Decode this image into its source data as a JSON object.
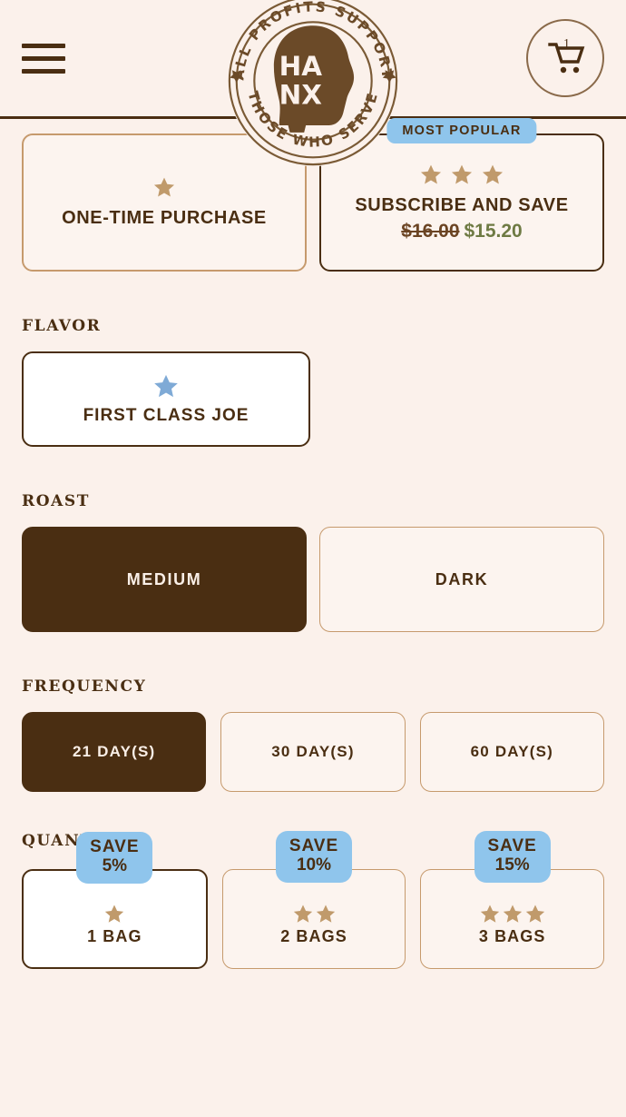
{
  "brand": {
    "logo_top_text": "ALL PROFITS SUPPORT",
    "logo_bottom_text": "THOSE WHO SERVE",
    "logo_initials_line1": "HA",
    "logo_initials_line2": "NX",
    "menu_icon": "hamburger-menu-icon",
    "cart_icon": "shopping-cart-icon",
    "cart_count": "1"
  },
  "colors": {
    "background": "#FBF1EB",
    "dark_brown": "#4A2E12",
    "tan_border": "#C69A6D",
    "star_tan": "#C09A6B",
    "star_blue": "#7FAAD6",
    "badge_blue": "#8FC5EC",
    "price_green": "#6E7A43",
    "cream": "#FCF4EF"
  },
  "plans": {
    "most_popular_label": "MOST POPULAR",
    "options": [
      {
        "title": "ONE-TIME PURCHASE",
        "stars": 1,
        "selected": false,
        "price_old": "",
        "price_new": ""
      },
      {
        "title": "SUBSCRIBE AND SAVE",
        "stars": 3,
        "selected": true,
        "price_old": "$16.00",
        "price_new": "$15.20"
      }
    ]
  },
  "flavor": {
    "label": "FLAVOR",
    "options": [
      {
        "name": "FIRST CLASS JOE",
        "selected": true
      }
    ]
  },
  "roast": {
    "label": "ROAST",
    "options": [
      {
        "name": "MEDIUM",
        "selected": true
      },
      {
        "name": "DARK",
        "selected": false
      }
    ]
  },
  "frequency": {
    "label": "FREQUENCY",
    "options": [
      {
        "name": "21 DAY(S)",
        "selected": true
      },
      {
        "name": "30 DAY(S)",
        "selected": false
      },
      {
        "name": "60 DAY(S)",
        "selected": false
      }
    ]
  },
  "quantity": {
    "label": "QUANTITY",
    "save_word": "SAVE",
    "options": [
      {
        "name": "1 BAG",
        "save": "5%",
        "stars": 1,
        "selected": true
      },
      {
        "name": "2 BAGS",
        "save": "10%",
        "stars": 2,
        "selected": false
      },
      {
        "name": "3 BAGS",
        "save": "15%",
        "stars": 3,
        "selected": false
      }
    ]
  }
}
